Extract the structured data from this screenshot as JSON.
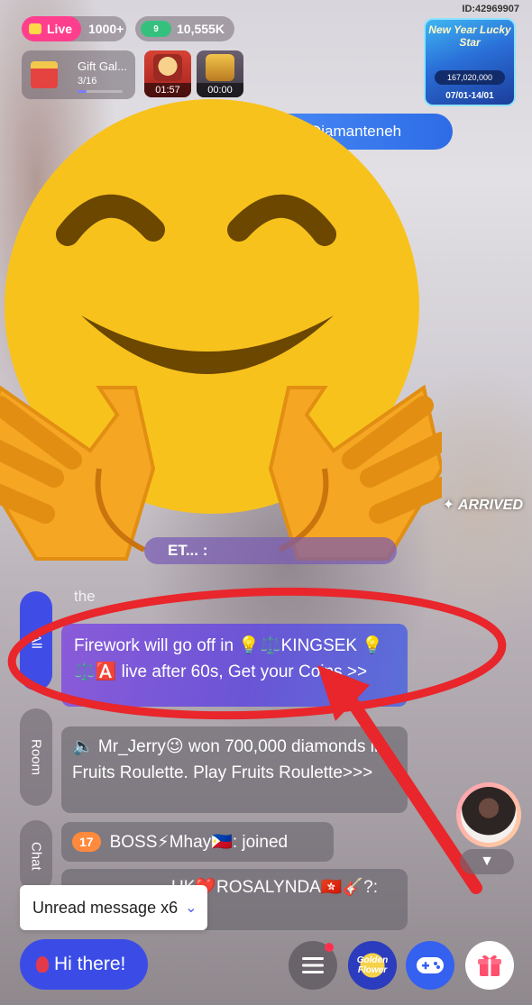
{
  "header": {
    "live_label": "Live",
    "viewers": "1000+",
    "coin_badge": "9",
    "coins": "10,555K",
    "room_id": "ID:42969907"
  },
  "gift_gallery": {
    "title": "Gift Gal...",
    "progress_text": "3/16",
    "progress": 0.19
  },
  "boxes": [
    {
      "timer": "01:57"
    },
    {
      "timer": "00:00"
    }
  ],
  "lucky_star": {
    "title": "New Year Lucky Star",
    "amount": "167,020,000",
    "dates": "07/01-14/01"
  },
  "welcome_banner": "Diamanteneh",
  "arrived_banner": "✦ ARRIVED",
  "partial_message": "ET...  :",
  "partial_text": "the",
  "tabs": {
    "all": "All",
    "room": "Room",
    "chat": "Chat"
  },
  "messages": {
    "firework": "Firework will go off in 💡⚖️KINGSEK 💡⚖️🅰️ live after 60s, Get your Coins >>",
    "jerry": "🔈  Mr_Jerry😉 won 700,000 diamonds in Fruits Roulette.  Play Fruits Roulette>>>",
    "boss_level": "17",
    "boss": "BOSS⚡Mhay🇵🇭: joined",
    "uk": "UK❤️ROSALYNDA🇭🇰🎸?:"
  },
  "unread": "Unread message x6",
  "bottom": {
    "hi_button": "Hi there!",
    "golden_flower": "Golden Flower"
  },
  "colors": {
    "accent_blue": "#3b4ce6",
    "live_pink": "#ff3f8e",
    "annotation_red": "#e8262b",
    "firework_purple": "#7a58d8"
  }
}
